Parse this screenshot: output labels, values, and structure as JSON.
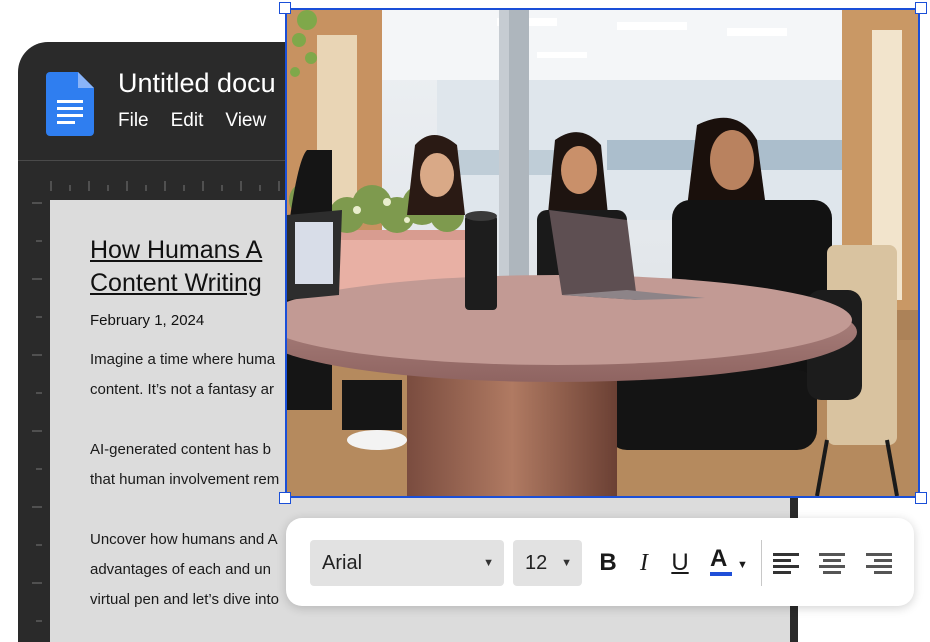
{
  "document": {
    "title": "Untitled docu",
    "menu": [
      "File",
      "Edit",
      "View"
    ],
    "heading_line1": "How Humans A",
    "heading_line2": "Content Writing",
    "date": "February 1, 2024",
    "paragraphs": [
      "Imagine a time where huma",
      "content. It’s not a fantasy ar",
      "AI-generated content has b",
      "that human involvement rem",
      "Uncover how humans and A",
      "advantages of each and un",
      "virtual pen and let’s dive into"
    ]
  },
  "toolbar": {
    "font": "Arial",
    "size": "12",
    "bold": "B",
    "italic": "I",
    "underline": "U",
    "text_color_letter": "A",
    "text_color": "#1f4fd8"
  },
  "icons": {
    "doc_app": "docs-icon",
    "align_left": "align-left-icon",
    "align_center": "align-center-icon",
    "align_right": "align-right-icon",
    "dropdown": "chevron-down-icon"
  },
  "colors": {
    "selection": "#1a4fd8",
    "doc_icon": "#2f7ef0",
    "window": "#2a2a2a",
    "paper": "#dcdcdc"
  }
}
